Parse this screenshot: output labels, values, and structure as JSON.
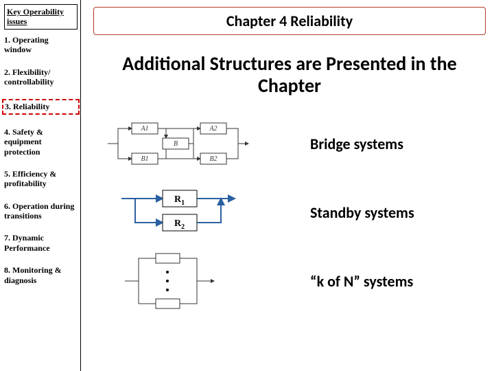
{
  "sidebar": {
    "header": "Key Operability issues",
    "items": [
      {
        "num": "1.",
        "txt": "Operating window"
      },
      {
        "num": "2.",
        "txt": "Flexibility/ controllability"
      },
      {
        "num": "3.",
        "txt": "Reliability"
      },
      {
        "num": "4.",
        "txt": "Safety & equipment protection"
      },
      {
        "num": "5.",
        "txt": "Efficiency & profitability"
      },
      {
        "num": "6.",
        "txt": "Operation during transitions"
      },
      {
        "num": "7.",
        "txt": "Dynamic Performance"
      },
      {
        "num": "8.",
        "txt": "Monitoring & diagnosis"
      }
    ]
  },
  "main": {
    "chapter_title": "Chapter 4 Reliability",
    "heading": "Additional Structures are Presented in the Chapter",
    "sections": [
      {
        "label": "Bridge systems"
      },
      {
        "label": "Standby systems"
      },
      {
        "label": "“k of N” systems"
      }
    ]
  },
  "diagrams": {
    "bridge": {
      "a1": "A1",
      "a2": "A2",
      "b": "B",
      "b1": "B1",
      "b2": "B2"
    },
    "standby": {
      "r1": "R",
      "r1s": "1",
      "r2": "R",
      "r2s": "2"
    }
  }
}
